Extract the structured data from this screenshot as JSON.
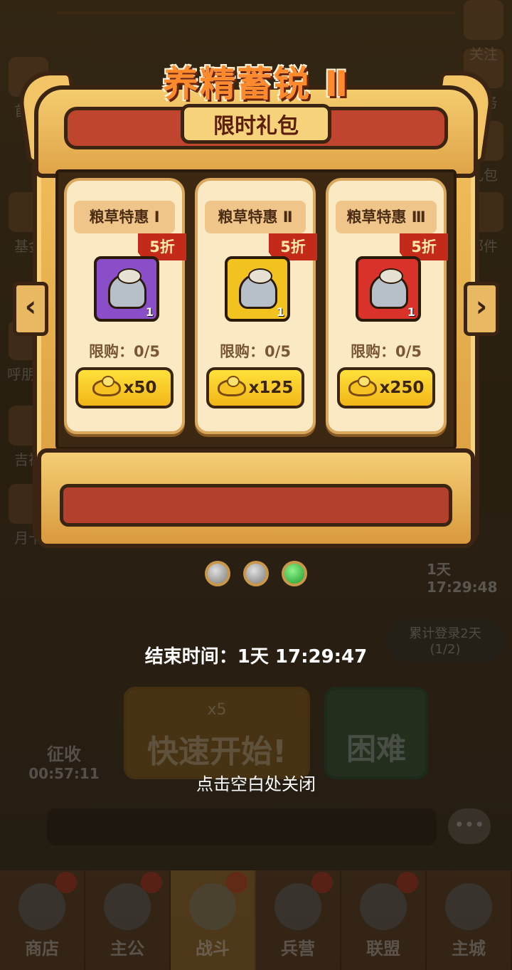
{
  "background": {
    "left_buttons": [
      "首充",
      "基金",
      "呼朋唤",
      "吉祥",
      "月卡"
    ],
    "right_buttons": [
      "关注",
      "任务",
      "礼包",
      "邮件"
    ],
    "side_timer": "1天 17:29:48",
    "login_pill": {
      "label": "累计登录2天",
      "progress": "(1/2)"
    },
    "collect": {
      "label": "征收",
      "time": "00:57:11"
    },
    "quick_start": {
      "cost": "x5",
      "label": "快速开始!"
    },
    "hard_button": "困难",
    "bottom_nav": [
      {
        "label": "商店",
        "active": false
      },
      {
        "label": "主公",
        "active": false
      },
      {
        "label": "战斗",
        "active": true
      },
      {
        "label": "兵营",
        "active": false
      },
      {
        "label": "联盟",
        "active": false
      },
      {
        "label": "主城",
        "active": false
      }
    ]
  },
  "popup": {
    "title": "养精蓄锐 Ⅱ",
    "subtitle": "限时礼包",
    "cards": [
      {
        "title": "粮草特惠 Ⅰ",
        "discount": "5折",
        "item_qty": "1",
        "item_color": "#8a4fc8",
        "limit": "限购：0/5",
        "price": "x50"
      },
      {
        "title": "粮草特惠 Ⅱ",
        "discount": "5折",
        "item_qty": "1",
        "item_color": "#f2c21e",
        "limit": "限购：0/5",
        "price": "x125"
      },
      {
        "title": "粮草特惠 Ⅲ",
        "discount": "5折",
        "item_qty": "1",
        "item_color": "#d9322a",
        "limit": "限购：0/5",
        "price": "x250"
      }
    ],
    "page_indicator": {
      "total": 3,
      "active": 3
    },
    "end_time": "结束时间：1天 17:29:47",
    "close_hint": "点击空白处关闭"
  }
}
